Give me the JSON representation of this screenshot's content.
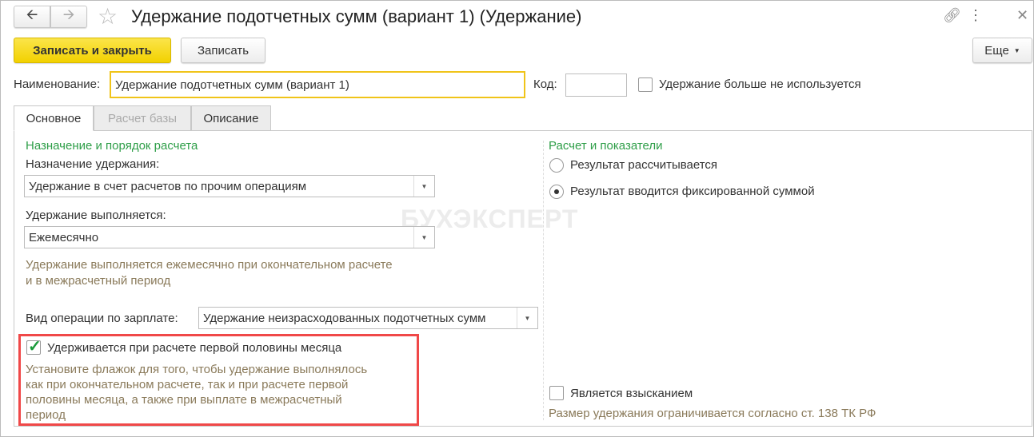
{
  "window": {
    "title": "Удержание подотчетных сумм (вариант 1) (Удержание)"
  },
  "toolbar": {
    "save_close": "Записать и закрыть",
    "save": "Записать",
    "more": "Еще"
  },
  "header": {
    "name_label": "Наименование:",
    "name_value": "Удержание подотчетных сумм (вариант 1)",
    "code_label": "Код:",
    "code_value": "",
    "unused_label": "Удержание больше не используется"
  },
  "tabs": [
    {
      "label": "Основное"
    },
    {
      "label": "Расчет базы"
    },
    {
      "label": "Описание"
    }
  ],
  "left": {
    "section_title": "Назначение и порядок расчета",
    "purpose_label": "Назначение удержания:",
    "purpose_value": "Удержание в счет расчетов по прочим операциям",
    "exec_label": "Удержание выполняется:",
    "exec_value": "Ежемесячно",
    "exec_hint_1": "Удержание выполняется ежемесячно при окончательном расчете",
    "exec_hint_2": "и в межрасчетный период",
    "op_label": "Вид операции по зарплате:",
    "op_value": "Удержание неизрасходованных подотчетных сумм",
    "first_half_label": "Удерживается при расчете первой половины месяца",
    "first_half_checked": true,
    "first_half_hint": [
      "Установите флажок для того, чтобы удержание выполнялось",
      "как при окончательном расчете, так и при расчете первой",
      "половины месяца, а также при выплате в межрасчетный",
      "период"
    ]
  },
  "right": {
    "section_title": "Расчет и показатели",
    "radio_1": "Результат рассчитывается",
    "radio_2": "Результат вводится фиксированной суммой",
    "selected_radio": 2,
    "recovery_label": "Является взысканием",
    "recovery_hint": "Размер удержания ограничивается согласно ст. 138 ТК РФ"
  },
  "watermark": "БУХЭКСПЕРТ",
  "colors": {
    "accent": "#f5d800",
    "highlight": "#f04848",
    "section": "#2e9e48"
  }
}
